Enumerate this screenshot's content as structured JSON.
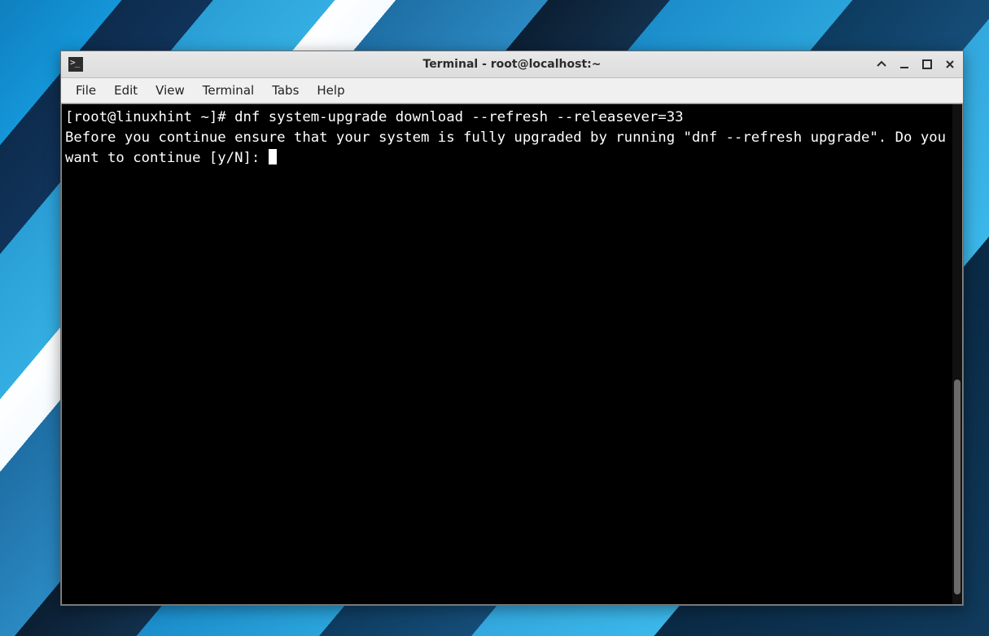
{
  "window": {
    "title": "Terminal - root@localhost:~"
  },
  "menubar": {
    "items": [
      "File",
      "Edit",
      "View",
      "Terminal",
      "Tabs",
      "Help"
    ]
  },
  "terminal": {
    "prompt": "[root@linuxhint ~]# ",
    "command": "dnf system-upgrade download --refresh --releasever=33",
    "output": "Before you continue ensure that your system is fully upgraded by running \"dnf --refresh upgrade\". Do you want to continue [y/N]: "
  }
}
